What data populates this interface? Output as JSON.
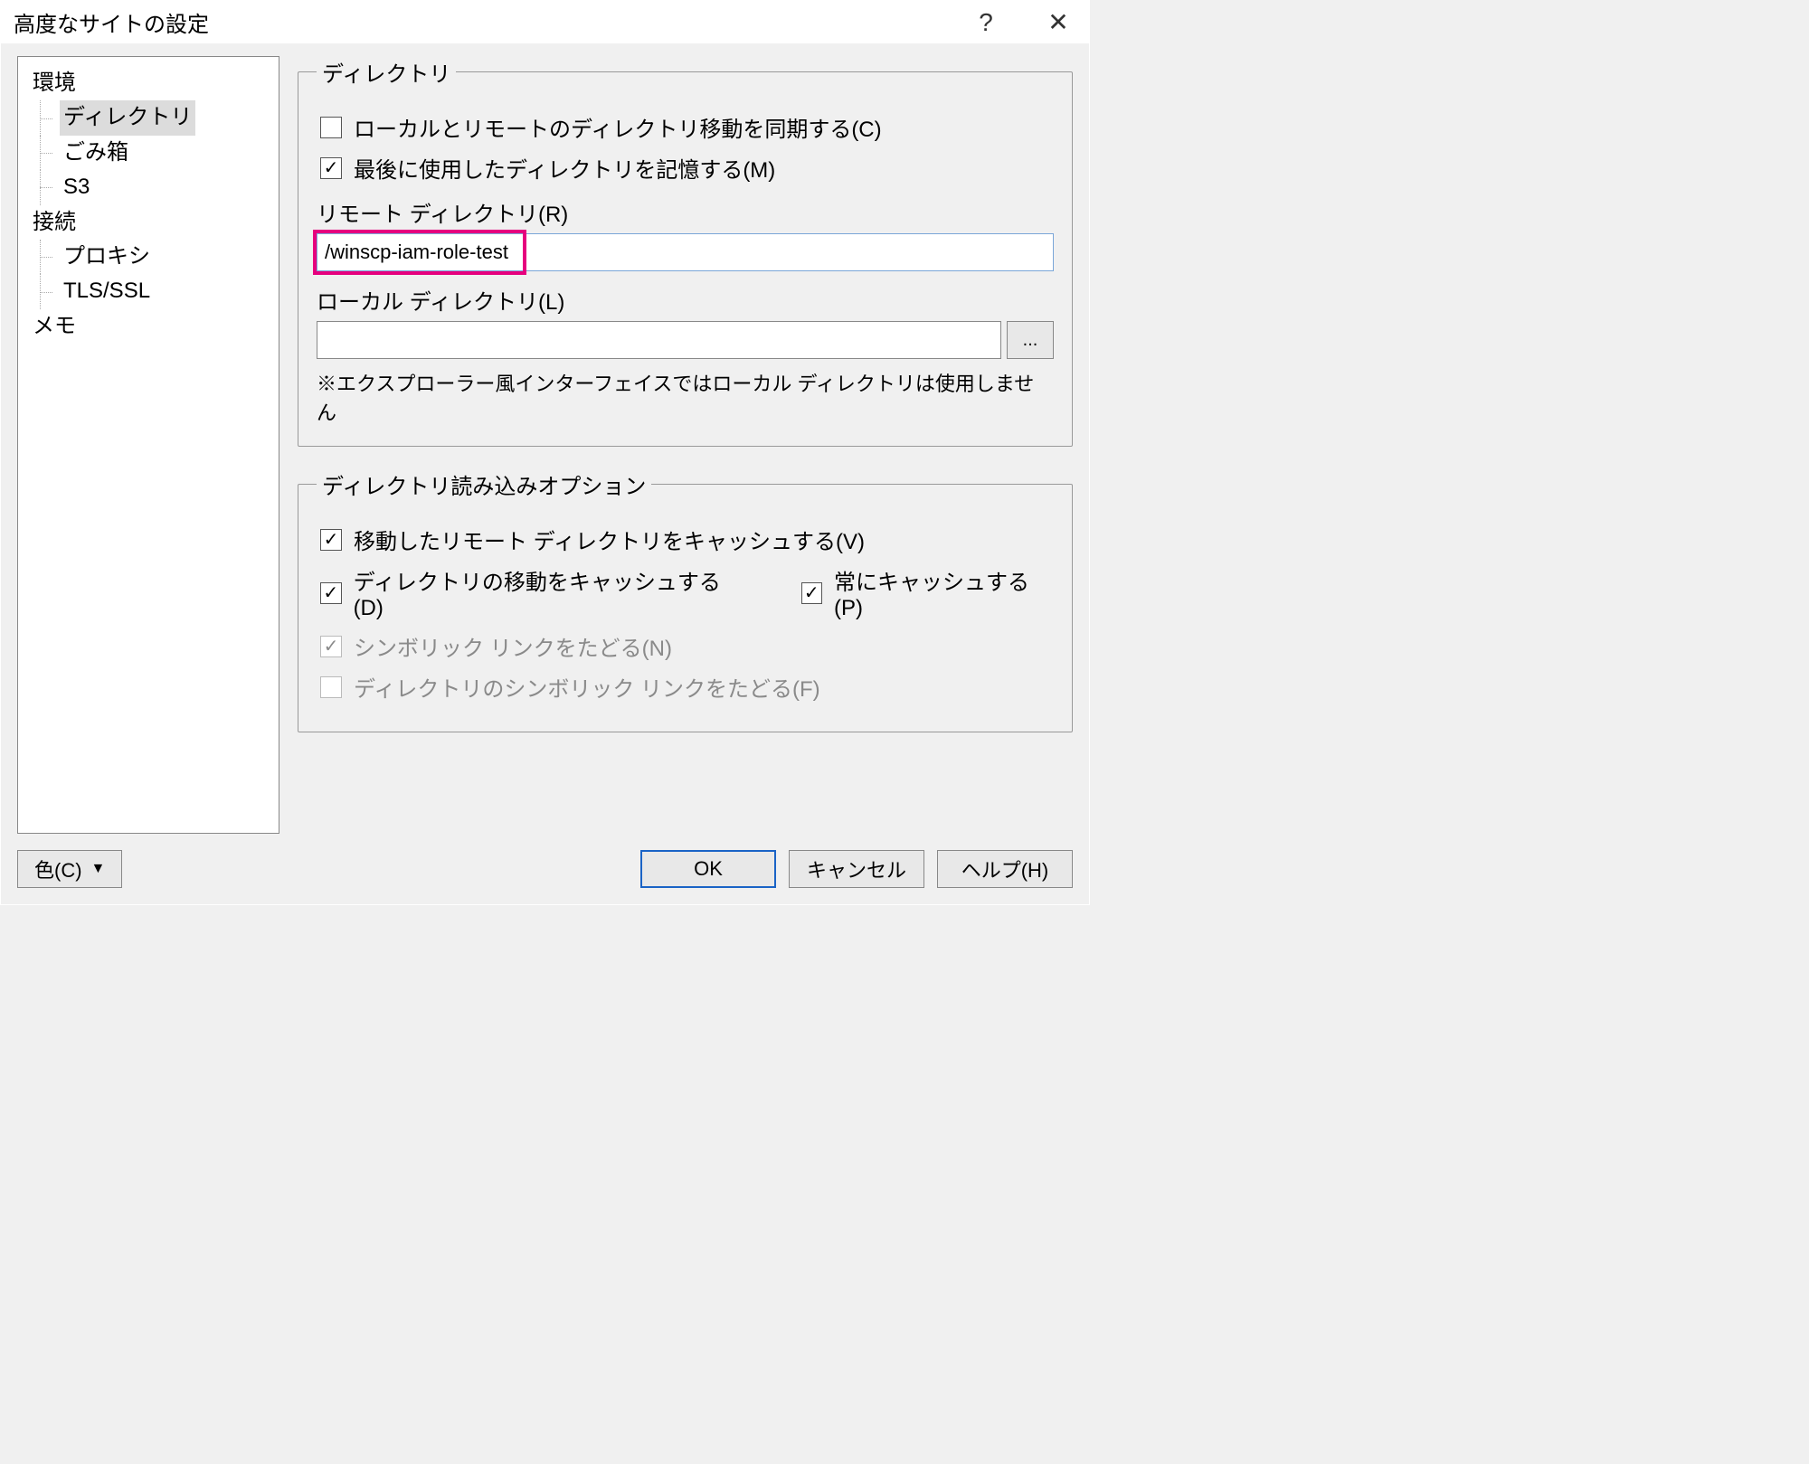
{
  "title": "高度なサイトの設定",
  "tree": {
    "env": "環境",
    "dir": "ディレクトリ",
    "trash": "ごみ箱",
    "s3": "S3",
    "conn": "接続",
    "proxy": "プロキシ",
    "tls": "TLS/SSL",
    "memo": "メモ"
  },
  "dir": {
    "legend": "ディレクトリ",
    "sync": "ローカルとリモートのディレクトリ移動を同期する(C)",
    "remember": "最後に使用したディレクトリを記憶する(M)",
    "remoteLabel": "リモート ディレクトリ(R)",
    "remoteValue": "/winscp-iam-role-test",
    "localLabel": "ローカル ディレクトリ(L)",
    "localValue": "",
    "browse": "...",
    "note": "※エクスプローラー風インターフェイスではローカル ディレクトリは使用しません"
  },
  "opts": {
    "legend": "ディレクトリ読み込みオプション",
    "cacheVisited": "移動したリモート ディレクトリをキャッシュする(V)",
    "cacheChanges": "ディレクトリの移動をキャッシュする(D)",
    "cacheAlways": "常にキャッシュする(P)",
    "resolveSym": "シンボリック リンクをたどる(N)",
    "resolveDirSym": "ディレクトリのシンボリック リンクをたどる(F)"
  },
  "footer": {
    "color": "色(C)",
    "ok": "OK",
    "cancel": "キャンセル",
    "help": "ヘルプ(H)"
  }
}
